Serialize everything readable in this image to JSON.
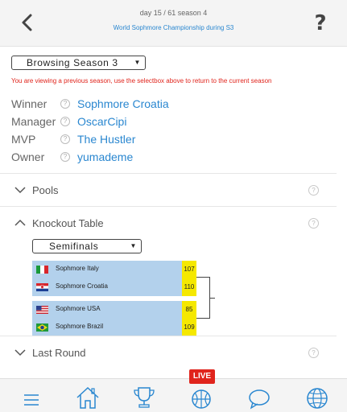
{
  "header": {
    "day_info": "day 15 / 61 season 4",
    "title": "World Sophmore Championship during S3",
    "help_label": "?"
  },
  "season": {
    "selected": "Browsing Season 3",
    "warning": "You are viewing a previous season, use the selectbox above to return to the current season"
  },
  "info": {
    "winner_label": "Winner",
    "winner_value": "Sophmore Croatia",
    "manager_label": "Manager",
    "manager_value": "OscarCipi",
    "mvp_label": "MVP",
    "mvp_value": "The Hustler",
    "owner_label": "Owner",
    "owner_value": "yumademe",
    "help_glyph": "?"
  },
  "sections": {
    "pools": "Pools",
    "knockout": "Knockout Table",
    "last_round": "Last Round"
  },
  "knockout": {
    "round_selected": "Semifinals",
    "matches": [
      {
        "teams": [
          {
            "name": "Sophmore Italy",
            "score": "107",
            "flag": "italy"
          },
          {
            "name": "Sophmore Croatia",
            "score": "110",
            "flag": "croatia"
          }
        ]
      },
      {
        "teams": [
          {
            "name": "Sophmore USA",
            "score": "85",
            "flag": "usa"
          },
          {
            "name": "Sophmore Brazil",
            "score": "109",
            "flag": "brazil"
          }
        ]
      }
    ]
  },
  "nav": {
    "live_label": "LIVE",
    "items": [
      "menu-icon",
      "home-icon",
      "trophy-icon",
      "basketball-icon",
      "chat-icon",
      "globe-icon"
    ]
  },
  "colors": {
    "accent": "#2a87d0",
    "warning": "#e0241c",
    "match_bg": "#b3d1ec",
    "score_bg": "#f5e800"
  }
}
